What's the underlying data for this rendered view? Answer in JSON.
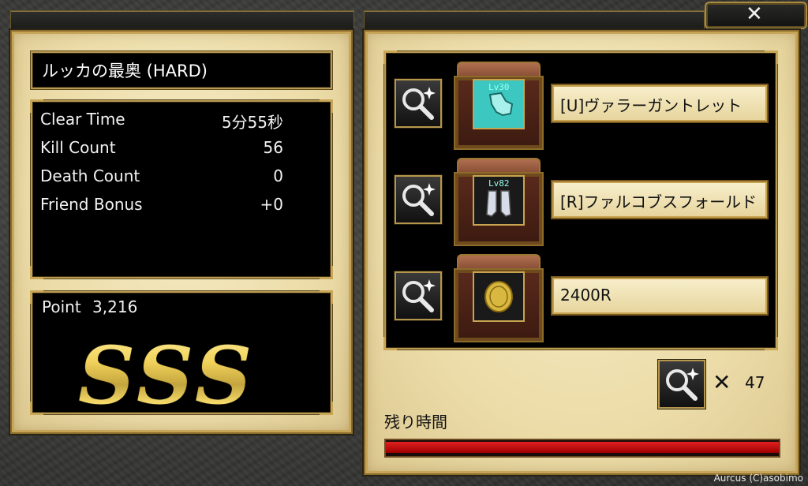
{
  "result": {
    "dungeon_title": "ルッカの最奥 (HARD)",
    "stats": [
      {
        "label": "Clear Time",
        "value": "5分55秒"
      },
      {
        "label": "Kill Count",
        "value": "56"
      },
      {
        "label": "Death Count",
        "value": "0"
      },
      {
        "label": "Friend Bonus",
        "value": "+0"
      }
    ],
    "point_label": "Point",
    "point_value": "3,216",
    "rank": "SSS"
  },
  "rewards": {
    "items": [
      {
        "name": "[U]ヴァラーガントレット",
        "level": "Lv30",
        "icon": "gauntlet-icon"
      },
      {
        "name": "[R]ファルコブスフォールド",
        "level": "Lv82",
        "icon": "greaves-icon"
      },
      {
        "name": "2400R",
        "icon": "coin-icon"
      }
    ],
    "magnifier_count_x": "✕",
    "magnifier_count": "47",
    "remaining_time_label": "残り時間",
    "remaining_time_fraction": 1.0
  },
  "close_label": "✕",
  "copyright": "Aurcus (C)asobimo",
  "colors": {
    "gold": "#c8a656",
    "timer_red": "#d01010"
  }
}
